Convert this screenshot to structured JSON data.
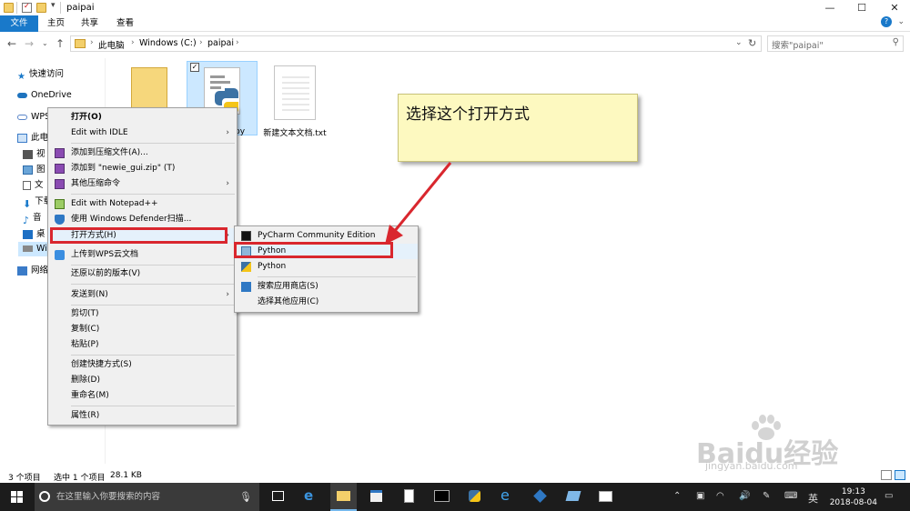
{
  "window": {
    "title": "paipai",
    "controls": {
      "minimize": "—",
      "maximize": "☐",
      "close": "✕"
    }
  },
  "ribbon": {
    "tabs": [
      "文件",
      "主页",
      "共享",
      "查看"
    ],
    "help": "?",
    "expand": "⌄"
  },
  "address": {
    "crumbs": [
      "此电脑",
      "Windows (C:)",
      "paipai"
    ],
    "refresh": "↻",
    "search_placeholder": "搜索\"paipai\""
  },
  "nav": {
    "items": [
      {
        "label": "快速访问",
        "icon": "star-icon"
      },
      {
        "label": "OneDrive",
        "icon": "cloud-icon"
      },
      {
        "label": "WPS",
        "icon": "cloud-icon"
      },
      {
        "label": "此电",
        "icon": "computer-icon"
      },
      {
        "label": "视",
        "icon": "video-icon"
      },
      {
        "label": "图",
        "icon": "picture-icon"
      },
      {
        "label": "文",
        "icon": "document-icon"
      },
      {
        "label": "下载",
        "icon": "download-icon"
      },
      {
        "label": "音",
        "icon": "music-icon"
      },
      {
        "label": "桌",
        "icon": "desktop-icon"
      },
      {
        "label": "Wi",
        "icon": "drive-icon"
      },
      {
        "label": "网络",
        "icon": "network-icon"
      }
    ]
  },
  "files": [
    {
      "name": "",
      "kind": "folder"
    },
    {
      "name": "py",
      "kind": "python"
    },
    {
      "name": "新建文本文档.txt",
      "kind": "text"
    }
  ],
  "context_menu": {
    "items": [
      {
        "label": "打开(O)",
        "bold": true
      },
      {
        "label": "Edit with IDLE",
        "submenu": true
      },
      {
        "label": "添加到压缩文件(A)..."
      },
      {
        "label": "添加到 \"newie_gui.zip\" (T)"
      },
      {
        "label": "其他压缩命令",
        "submenu": true
      },
      {
        "label": "Edit with Notepad++"
      },
      {
        "label": "使用 Windows Defender扫描..."
      },
      {
        "label": "打开方式(H)",
        "submenu": true
      },
      {
        "label": "上传到WPS云文档"
      },
      {
        "label": "还原以前的版本(V)"
      },
      {
        "label": "发送到(N)",
        "submenu": true
      },
      {
        "label": "剪切(T)"
      },
      {
        "label": "复制(C)"
      },
      {
        "label": "粘贴(P)"
      },
      {
        "label": "创建快捷方式(S)"
      },
      {
        "label": "删除(D)"
      },
      {
        "label": "重命名(M)"
      },
      {
        "label": "属性(R)"
      }
    ]
  },
  "open_with_menu": {
    "items": [
      {
        "label": "PyCharm Community Edition"
      },
      {
        "label": "Python"
      },
      {
        "label": "Python"
      },
      {
        "label": "搜索应用商店(S)"
      },
      {
        "label": "选择其他应用(C)"
      }
    ]
  },
  "annotation": {
    "note": "选择这个打开方式"
  },
  "status": {
    "count": "3 个项目",
    "selected": "选中 1 个项目",
    "size": "28.1 KB"
  },
  "taskbar": {
    "search_placeholder": "在这里输入你要搜索的内容",
    "time": "19:13",
    "date": "2018-08-04",
    "ime": "英"
  },
  "watermark": {
    "brand": "Baidu经验",
    "url": "jingyan.baidu.com"
  },
  "colors": {
    "accent": "#1979ca",
    "highlight": "#d9272e",
    "note_bg": "#fdf9c0"
  }
}
